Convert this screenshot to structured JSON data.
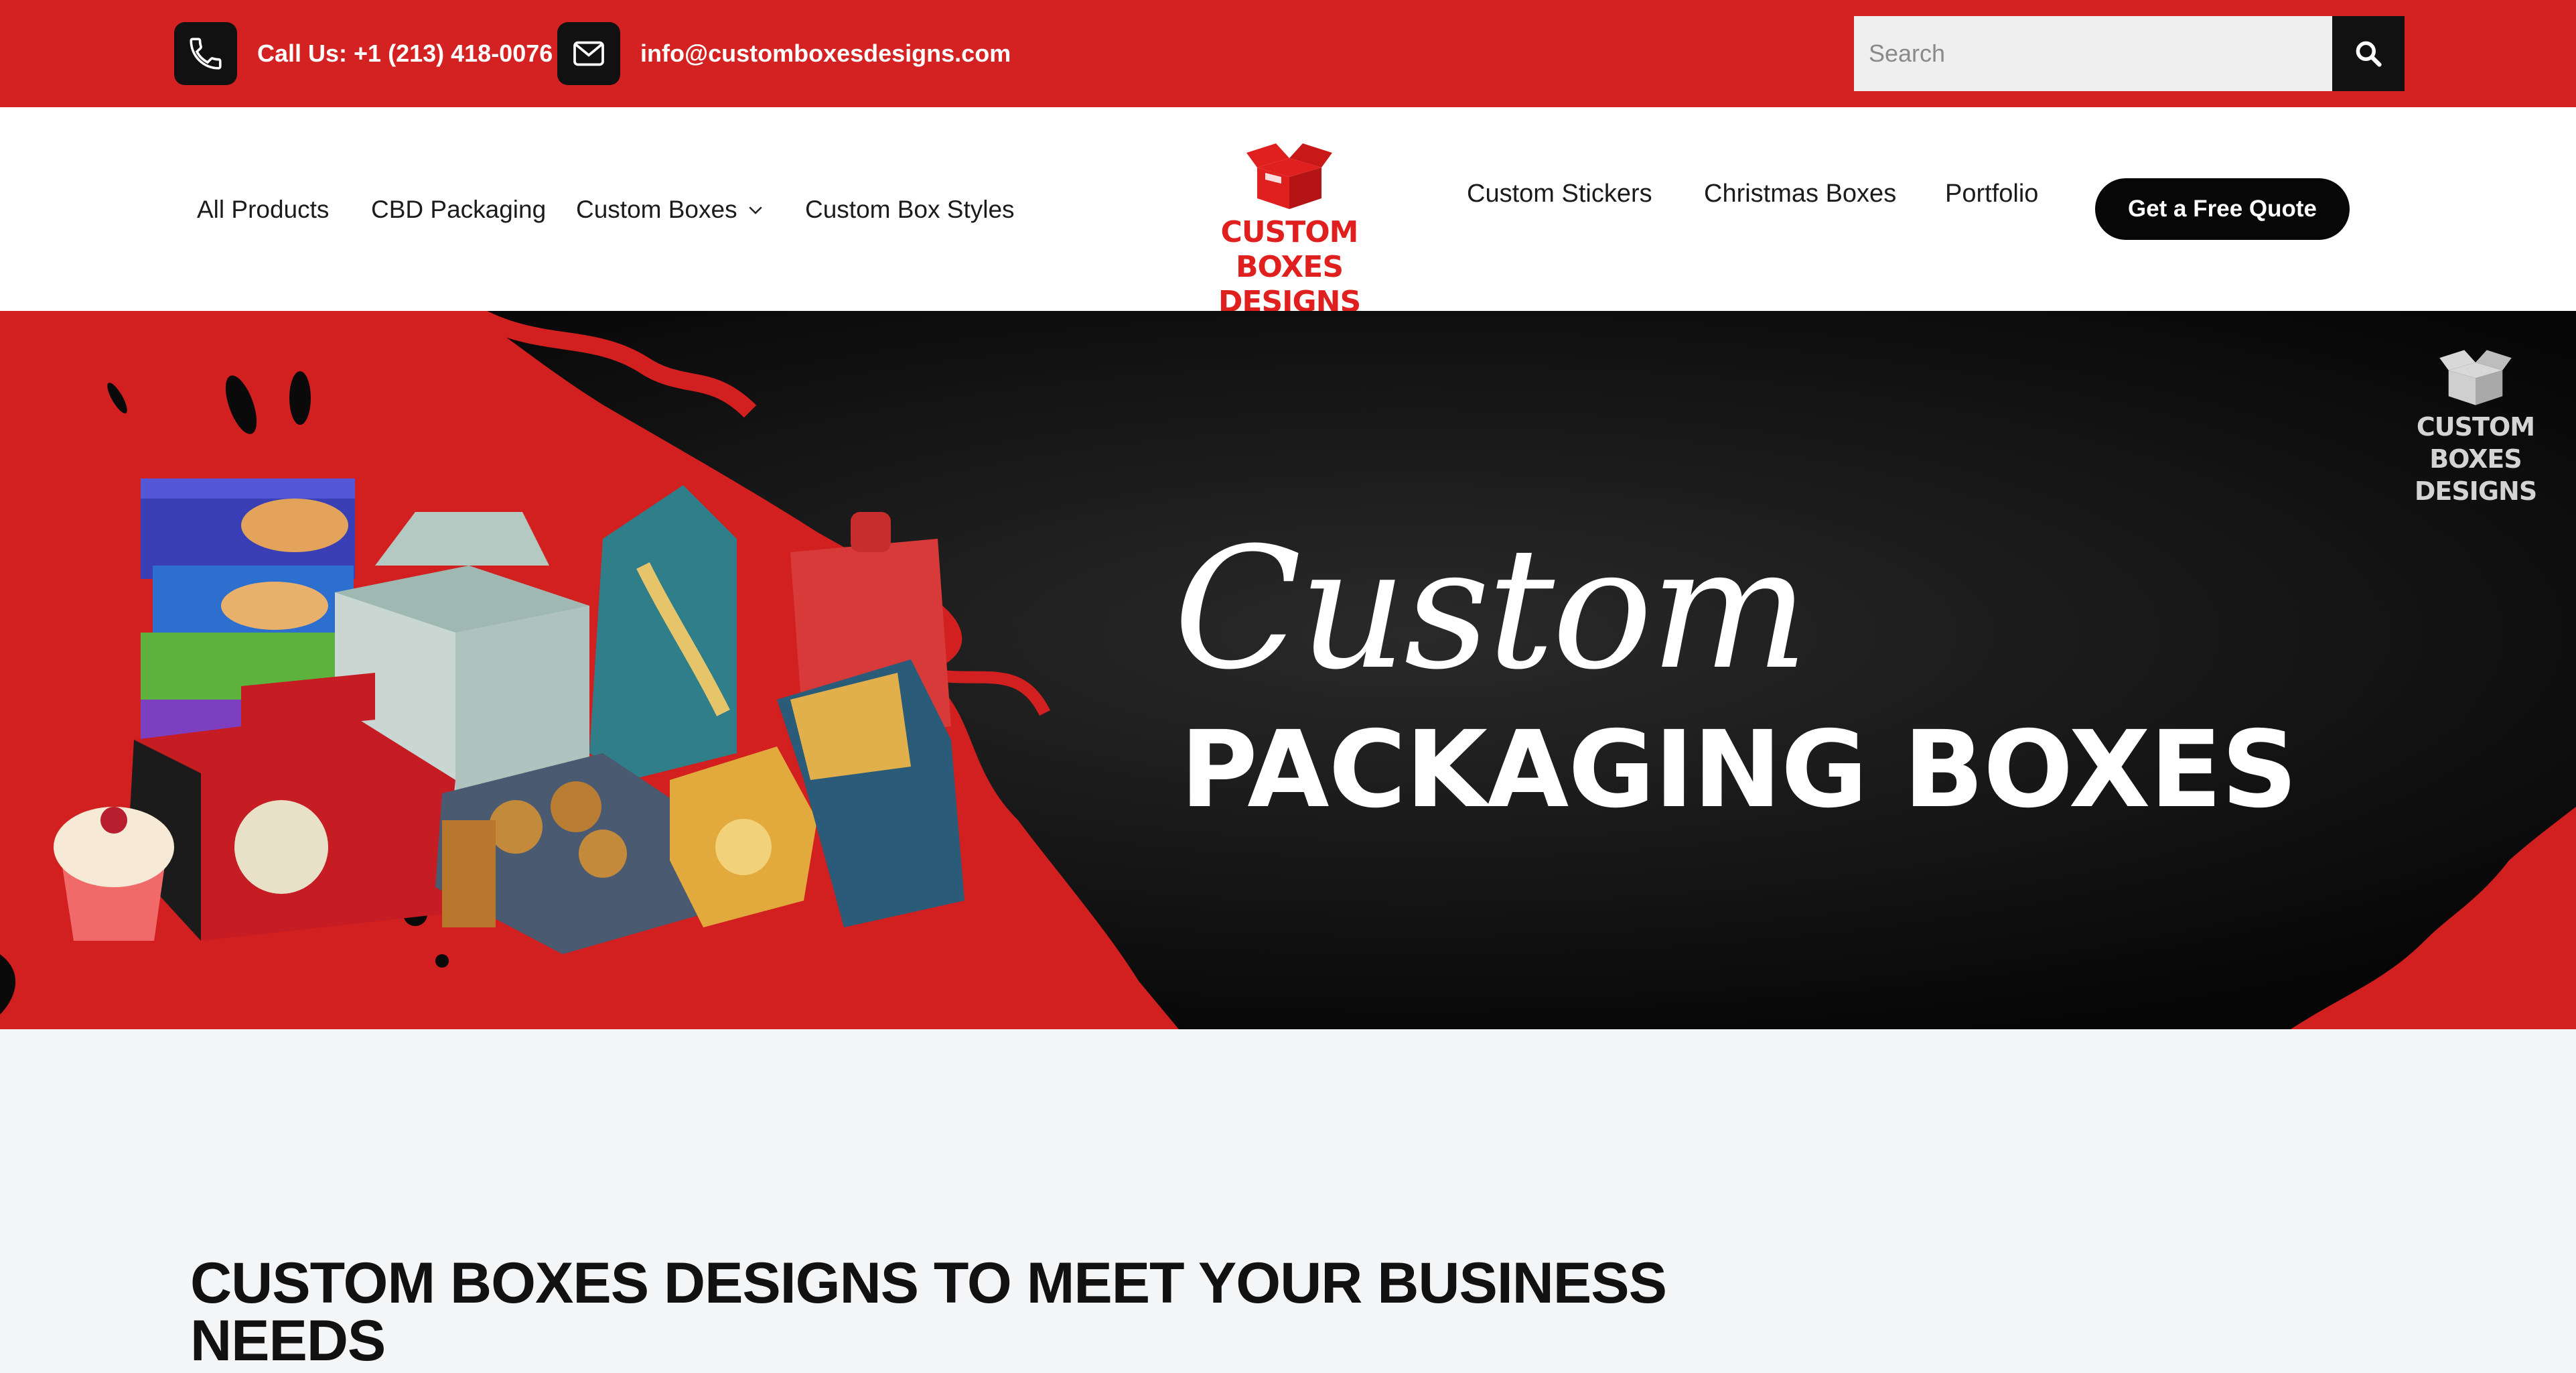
{
  "topbar": {
    "phone_text": "Call Us: +1 (213) 418-0076",
    "email_text": "info@customboxesdesigns.com",
    "search_placeholder": "Search",
    "phone_icon": "phone-icon",
    "email_icon": "mail-icon",
    "search_icon": "search-icon"
  },
  "nav": {
    "left": [
      "All Products",
      "CBD Packaging",
      "Custom Boxes",
      "Custom Box Styles"
    ],
    "right": [
      "Custom Stickers",
      "Christmas Boxes",
      "Portfolio"
    ],
    "quote_label": "Get a Free Quote",
    "dropdown_icon": "chevron-down-icon"
  },
  "logo": {
    "line1": "CUSTOM",
    "line2": "BOXES DESIGNS"
  },
  "hero": {
    "script_text": "Custom",
    "bold_text": "PACKAGING BOXES",
    "watermark_line1": "CUSTOM",
    "watermark_line2": "BOXES DESIGNS"
  },
  "content": {
    "heading": "CUSTOM BOXES DESIGNS TO MEET YOUR BUSINESS NEEDS"
  },
  "colors": {
    "brand_red": "#d42222",
    "dark": "#070707",
    "page_bg": "#f4f5f7"
  }
}
